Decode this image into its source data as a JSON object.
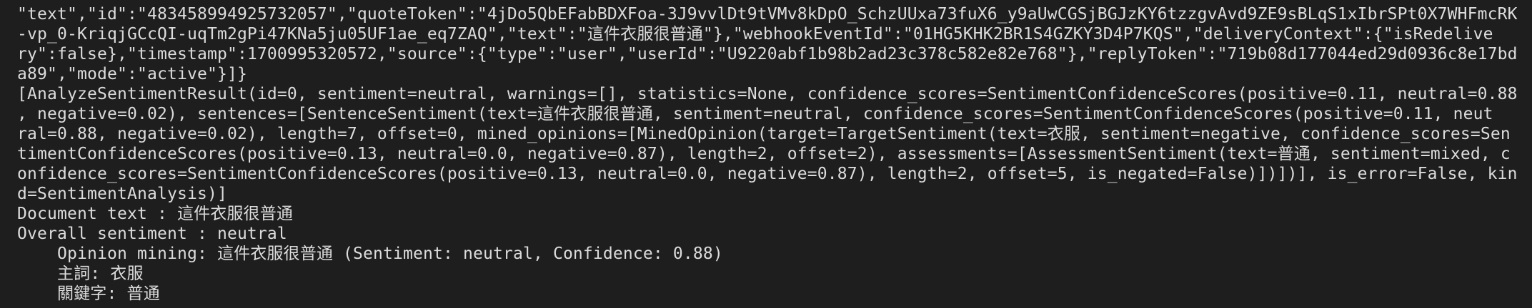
{
  "terminal": {
    "lines": [
      "\"text\",\"id\":\"483458994925732057\",\"quoteToken\":\"4jDo5QbEFabBDXFoa-3J9vvlDt9tVMv8kDpO_SchzUUxa73fuX6_y9aUwCGSjBGJzKY6tzzgvAvd9ZE9sBLqS1xIbrSPt0X7WHFmcRK",
      "-vp_0-KriqjGCcQI-uqTm2gPi47KNa5ju05UF1ae_eq7ZAQ\",\"text\":\"這件衣服很普通\"},\"webhookEventId\":\"01HG5KHK2BR1S4GZKY3D4P7KQS\",\"deliveryContext\":{\"isRedelive",
      "ry\":false},\"timestamp\":1700995320572,\"source\":{\"type\":\"user\",\"userId\":\"U9220abf1b98b2ad23c378c582e82e768\"},\"replyToken\":\"719b08d177044ed29d0936c8e17bd",
      "a89\",\"mode\":\"active\"}]}",
      "[AnalyzeSentimentResult(id=0, sentiment=neutral, warnings=[], statistics=None, confidence_scores=SentimentConfidenceScores(positive=0.11, neutral=0.88",
      ", negative=0.02), sentences=[SentenceSentiment(text=這件衣服很普通, sentiment=neutral, confidence_scores=SentimentConfidenceScores(positive=0.11, neut",
      "ral=0.88, negative=0.02), length=7, offset=0, mined_opinions=[MinedOpinion(target=TargetSentiment(text=衣服, sentiment=negative, confidence_scores=Sen",
      "timentConfidenceScores(positive=0.13, neutral=0.0, negative=0.87), length=2, offset=2), assessments=[AssessmentSentiment(text=普通, sentiment=mixed, c",
      "onfidence_scores=SentimentConfidenceScores(positive=0.13, neutral=0.0, negative=0.87), length=2, offset=5, is_negated=False)])])], is_error=False, kin",
      "d=SentimentAnalysis)]",
      "Document text : 這件衣服很普通",
      "Overall sentiment : neutral"
    ],
    "indented_lines": [
      "Opinion mining: 這件衣服很普通 (Sentiment: neutral, Confidence: 0.88)",
      "主詞: 衣服",
      "關鍵字: 普通"
    ]
  }
}
